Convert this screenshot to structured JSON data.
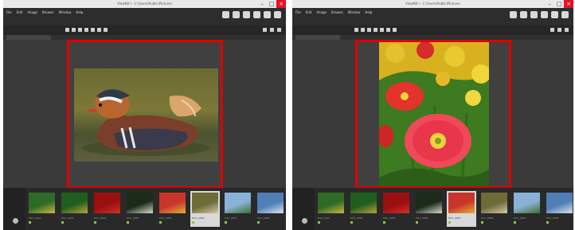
{
  "windows": [
    {
      "title": "ViewNX-i - C:\\Users\\Public\\Pictures",
      "menu": [
        "File",
        "Edit",
        "Image",
        "Browse",
        "Window",
        "Help"
      ],
      "thumbnails": [
        {
          "label": "DSC_0001",
          "colors": [
            "#2f6a26",
            "#c8b844"
          ]
        },
        {
          "label": "DSC_0002",
          "colors": [
            "#1f5e1e",
            "#b8a23a"
          ]
        },
        {
          "label": "DSC_0003",
          "colors": [
            "#9b0f0f",
            "#d2302a"
          ]
        },
        {
          "label": "DSC_0004",
          "colors": [
            "#1c2a1a",
            "#d8d8d0"
          ]
        },
        {
          "label": "DSC_0005",
          "colors": [
            "#c9352a",
            "#e0b034"
          ]
        },
        {
          "label": "DSC_0006",
          "colors": [
            "#6d6b37",
            "#d6c8a8"
          ]
        },
        {
          "label": "DSC_0007",
          "colors": [
            "#8ab2d6",
            "#3d6f2a"
          ]
        },
        {
          "label": "DSC_0008",
          "colors": [
            "#4f7fb5",
            "#d9e4ee"
          ]
        }
      ],
      "selected_index": 5
    },
    {
      "title": "ViewNX-i - C:\\Users\\Public\\Pictures",
      "menu": [
        "File",
        "Edit",
        "Image",
        "Browse",
        "Window",
        "Help"
      ],
      "thumbnails": [
        {
          "label": "DSC_0001",
          "colors": [
            "#2f6a26",
            "#c8b844"
          ]
        },
        {
          "label": "DSC_0002",
          "colors": [
            "#1f5e1e",
            "#b8a23a"
          ]
        },
        {
          "label": "DSC_0003",
          "colors": [
            "#9b0f0f",
            "#d2302a"
          ]
        },
        {
          "label": "DSC_0004",
          "colors": [
            "#1c2a1a",
            "#d8d8d0"
          ]
        },
        {
          "label": "DSC_0005",
          "colors": [
            "#c9352a",
            "#e0b034"
          ]
        },
        {
          "label": "DSC_0006",
          "colors": [
            "#6d6b37",
            "#d6c8a8"
          ]
        },
        {
          "label": "DSC_0007",
          "colors": [
            "#8ab2d6",
            "#3d6f2a"
          ]
        },
        {
          "label": "DSC_0008",
          "colors": [
            "#4f7fb5",
            "#d9e4ee"
          ]
        }
      ],
      "selected_index": 4
    }
  ],
  "colors": {
    "highlight": "#e00000",
    "app_background": "#3b3b3b",
    "filmstrip_background": "#292929",
    "selected_thumb": "#d9d9d9"
  }
}
